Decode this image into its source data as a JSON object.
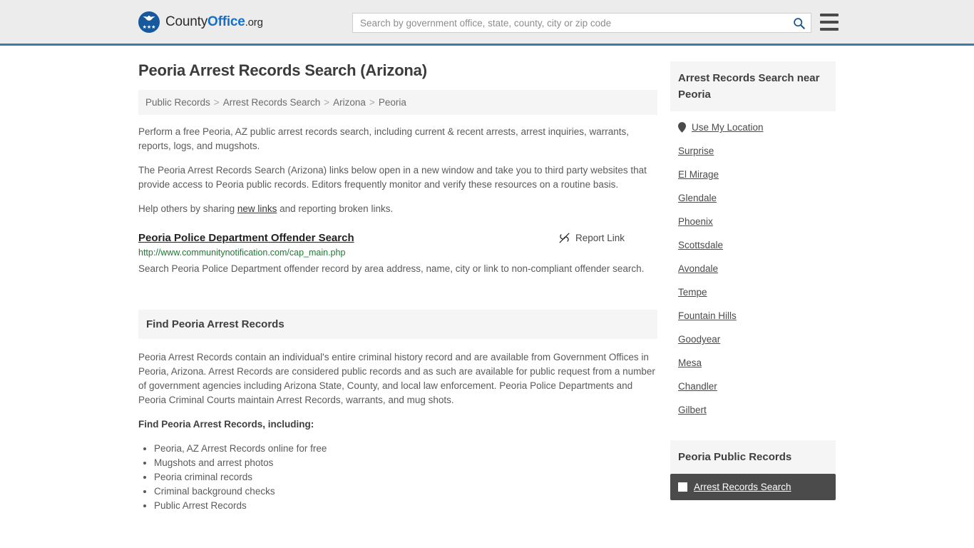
{
  "header": {
    "brand": {
      "part1": "County",
      "part2": "Office",
      "part3": ".org",
      "logo_icon": "eagle-stars-seal-icon"
    },
    "search": {
      "placeholder": "Search by government office, state, county, city or zip code",
      "value": "",
      "icon": "search-icon"
    },
    "menu_icon": "hamburger-menu-icon"
  },
  "main": {
    "title": "Peoria Arrest Records Search (Arizona)",
    "breadcrumb": [
      {
        "label": "Public Records"
      },
      {
        "label": "Arrest Records Search"
      },
      {
        "label": "Arizona"
      },
      {
        "label": "Peoria"
      }
    ],
    "breadcrumb_separator": ">",
    "intro_paragraph": "Perform a free Peoria, AZ public arrest records search, including current & recent arrests, arrest inquiries, warrants, reports, logs, and mugshots.",
    "second_paragraph": "The Peoria Arrest Records Search (Arizona) links below open in a new window and take you to third party websites that provide access to Peoria public records. Editors frequently monitor and verify these resources on a routine basis.",
    "share_prefix": "Help others by sharing ",
    "share_link": "new links",
    "share_suffix": " and reporting broken links.",
    "result": {
      "title": "Peoria Police Department Offender Search",
      "report_label": "Report Link",
      "report_icon": "broken-link-icon",
      "url": "http://www.communitynotification.com/cap_main.php",
      "description": "Search Peoria Police Department offender record by area address, name, city or link to non-compliant offender search."
    },
    "section": {
      "heading": "Find Peoria Arrest Records",
      "paragraph": "Peoria Arrest Records contain an individual's entire criminal history record and are available from Government Offices in Peoria, Arizona. Arrest Records are considered public records and as such are available for public request from a number of government agencies including Arizona State, County, and local law enforcement. Peoria Police Departments and Peoria Criminal Courts maintain Arrest Records, warrants, and mug shots.",
      "list_lead": "Find Peoria Arrest Records, including:",
      "bullets": [
        "Peoria, AZ Arrest Records online for free",
        "Mugshots and arrest photos",
        "Peoria criminal records",
        "Criminal background checks",
        "Public Arrest Records"
      ]
    }
  },
  "sidebar": {
    "nearby": {
      "heading": "Arrest Records Search near Peoria",
      "location_icon": "map-pin-icon",
      "items": [
        {
          "label": "Use My Location",
          "has_icon": true
        },
        {
          "label": "Surprise",
          "has_icon": false
        },
        {
          "label": "El Mirage",
          "has_icon": false
        },
        {
          "label": "Glendale",
          "has_icon": false
        },
        {
          "label": "Phoenix",
          "has_icon": false
        },
        {
          "label": "Scottsdale",
          "has_icon": false
        },
        {
          "label": "Avondale",
          "has_icon": false
        },
        {
          "label": "Tempe",
          "has_icon": false
        },
        {
          "label": "Fountain Hills",
          "has_icon": false
        },
        {
          "label": "Goodyear",
          "has_icon": false
        },
        {
          "label": "Mesa",
          "has_icon": false
        },
        {
          "label": "Chandler",
          "has_icon": false
        },
        {
          "label": "Gilbert",
          "has_icon": false
        }
      ]
    },
    "public_records": {
      "heading": "Peoria Public Records",
      "items": [
        {
          "label": "Arrest Records Search",
          "icon": "square-document-icon",
          "active": true
        }
      ]
    }
  },
  "colors": {
    "header_bg": "#ececec",
    "header_border": "#3a7ca8",
    "brand_blue": "#1a6fc4",
    "panel_bg": "#f5f5f5",
    "url_green": "#1d7a33",
    "active_item_bg": "#4b4b4b"
  }
}
